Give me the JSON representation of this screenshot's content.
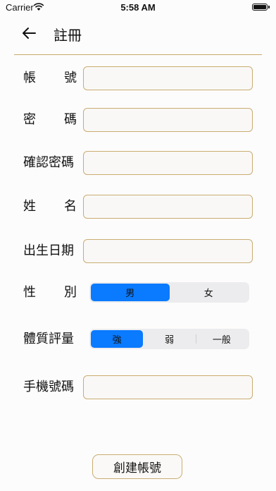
{
  "status_bar": {
    "carrier": "Carrier",
    "time": "5:58 AM"
  },
  "nav": {
    "title": "註冊"
  },
  "form": {
    "account": {
      "label_chars": [
        "帳",
        "號"
      ],
      "value": ""
    },
    "password": {
      "label_chars": [
        "密",
        "碼"
      ],
      "value": ""
    },
    "confirm_password": {
      "label": "確認密碼",
      "value": ""
    },
    "name": {
      "label_chars": [
        "姓",
        "名"
      ],
      "value": ""
    },
    "birthday": {
      "label": "出生日期",
      "value": ""
    },
    "gender": {
      "label_chars": [
        "性",
        "別"
      ],
      "options": [
        "男",
        "女"
      ],
      "selected": "男"
    },
    "constitution": {
      "label": "體質評量",
      "options": [
        "強",
        "弱",
        "一般"
      ],
      "selected": "強"
    },
    "phone": {
      "label": "手機號碼",
      "value": ""
    }
  },
  "create_button": "創建帳號",
  "colors": {
    "accent": "#0a7aff",
    "border_gold": "#c9ad72"
  },
  "icons": {
    "back": "arrow-left-icon",
    "wifi": "wifi-icon",
    "battery": "battery-icon"
  }
}
